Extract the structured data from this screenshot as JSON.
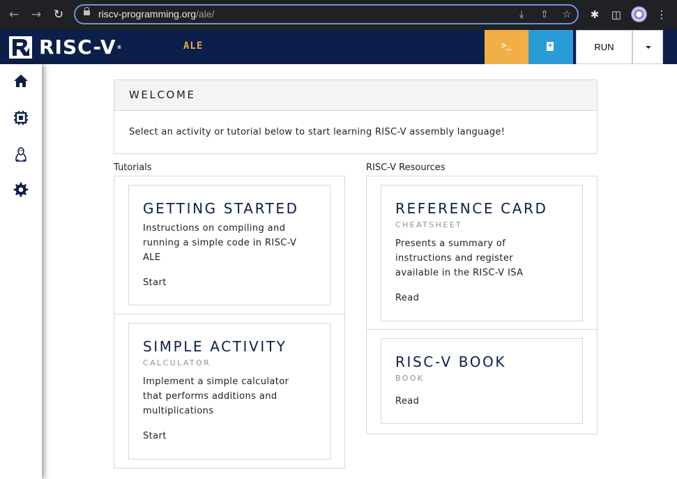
{
  "browser": {
    "url_host": "riscv-programming.org",
    "url_path": "/ale/",
    "icons": [
      "back-icon",
      "forward-icon",
      "reload-icon",
      "lock-icon",
      "install-icon",
      "share-icon",
      "star-icon",
      "extensions-icon",
      "side-panel-icon",
      "profile-avatar",
      "menu-icon"
    ]
  },
  "header": {
    "logo_text": "RISC-V",
    "logo_reg": "®",
    "app_name": "ALE",
    "terminal_label": ">_",
    "run_label": "RUN",
    "colors": {
      "bar": "#0c1f4a",
      "terminal": "#f2ae47",
      "file": "#2a9bd6",
      "app_name": "#e8a347"
    }
  },
  "sidebar": {
    "items": [
      {
        "icon": "home-icon"
      },
      {
        "icon": "chip-icon"
      },
      {
        "icon": "linux-icon"
      },
      {
        "icon": "settings-icon"
      }
    ]
  },
  "welcome": {
    "title": "WELCOME",
    "text": "Select an activity or tutorial below to start learning RISC-V assembly language!"
  },
  "tutorials": {
    "label": "Tutorials",
    "cards": [
      {
        "title": "GETTING STARTED",
        "desc_lines": [
          "Instructions on compiling and",
          "running a simple code in RISC-V",
          "ALE"
        ],
        "link": "Start"
      },
      {
        "title": "SIMPLE ACTIVITY",
        "subtitle": "CALCULATOR",
        "desc_lines": [
          "Implement a simple calculator",
          "that performs additions and",
          "multiplications"
        ],
        "link": "Start"
      }
    ]
  },
  "resources": {
    "label": "RISC-V Resources",
    "cards": [
      {
        "title": "REFERENCE CARD",
        "subtitle": "CHEATSHEET",
        "desc_lines": [
          "Presents a summary of",
          "instructions and register",
          "available in the RISC-V ISA"
        ],
        "link": "Read"
      },
      {
        "title": "RISC-V BOOK",
        "subtitle": "BOOK",
        "link": "Read"
      }
    ]
  }
}
